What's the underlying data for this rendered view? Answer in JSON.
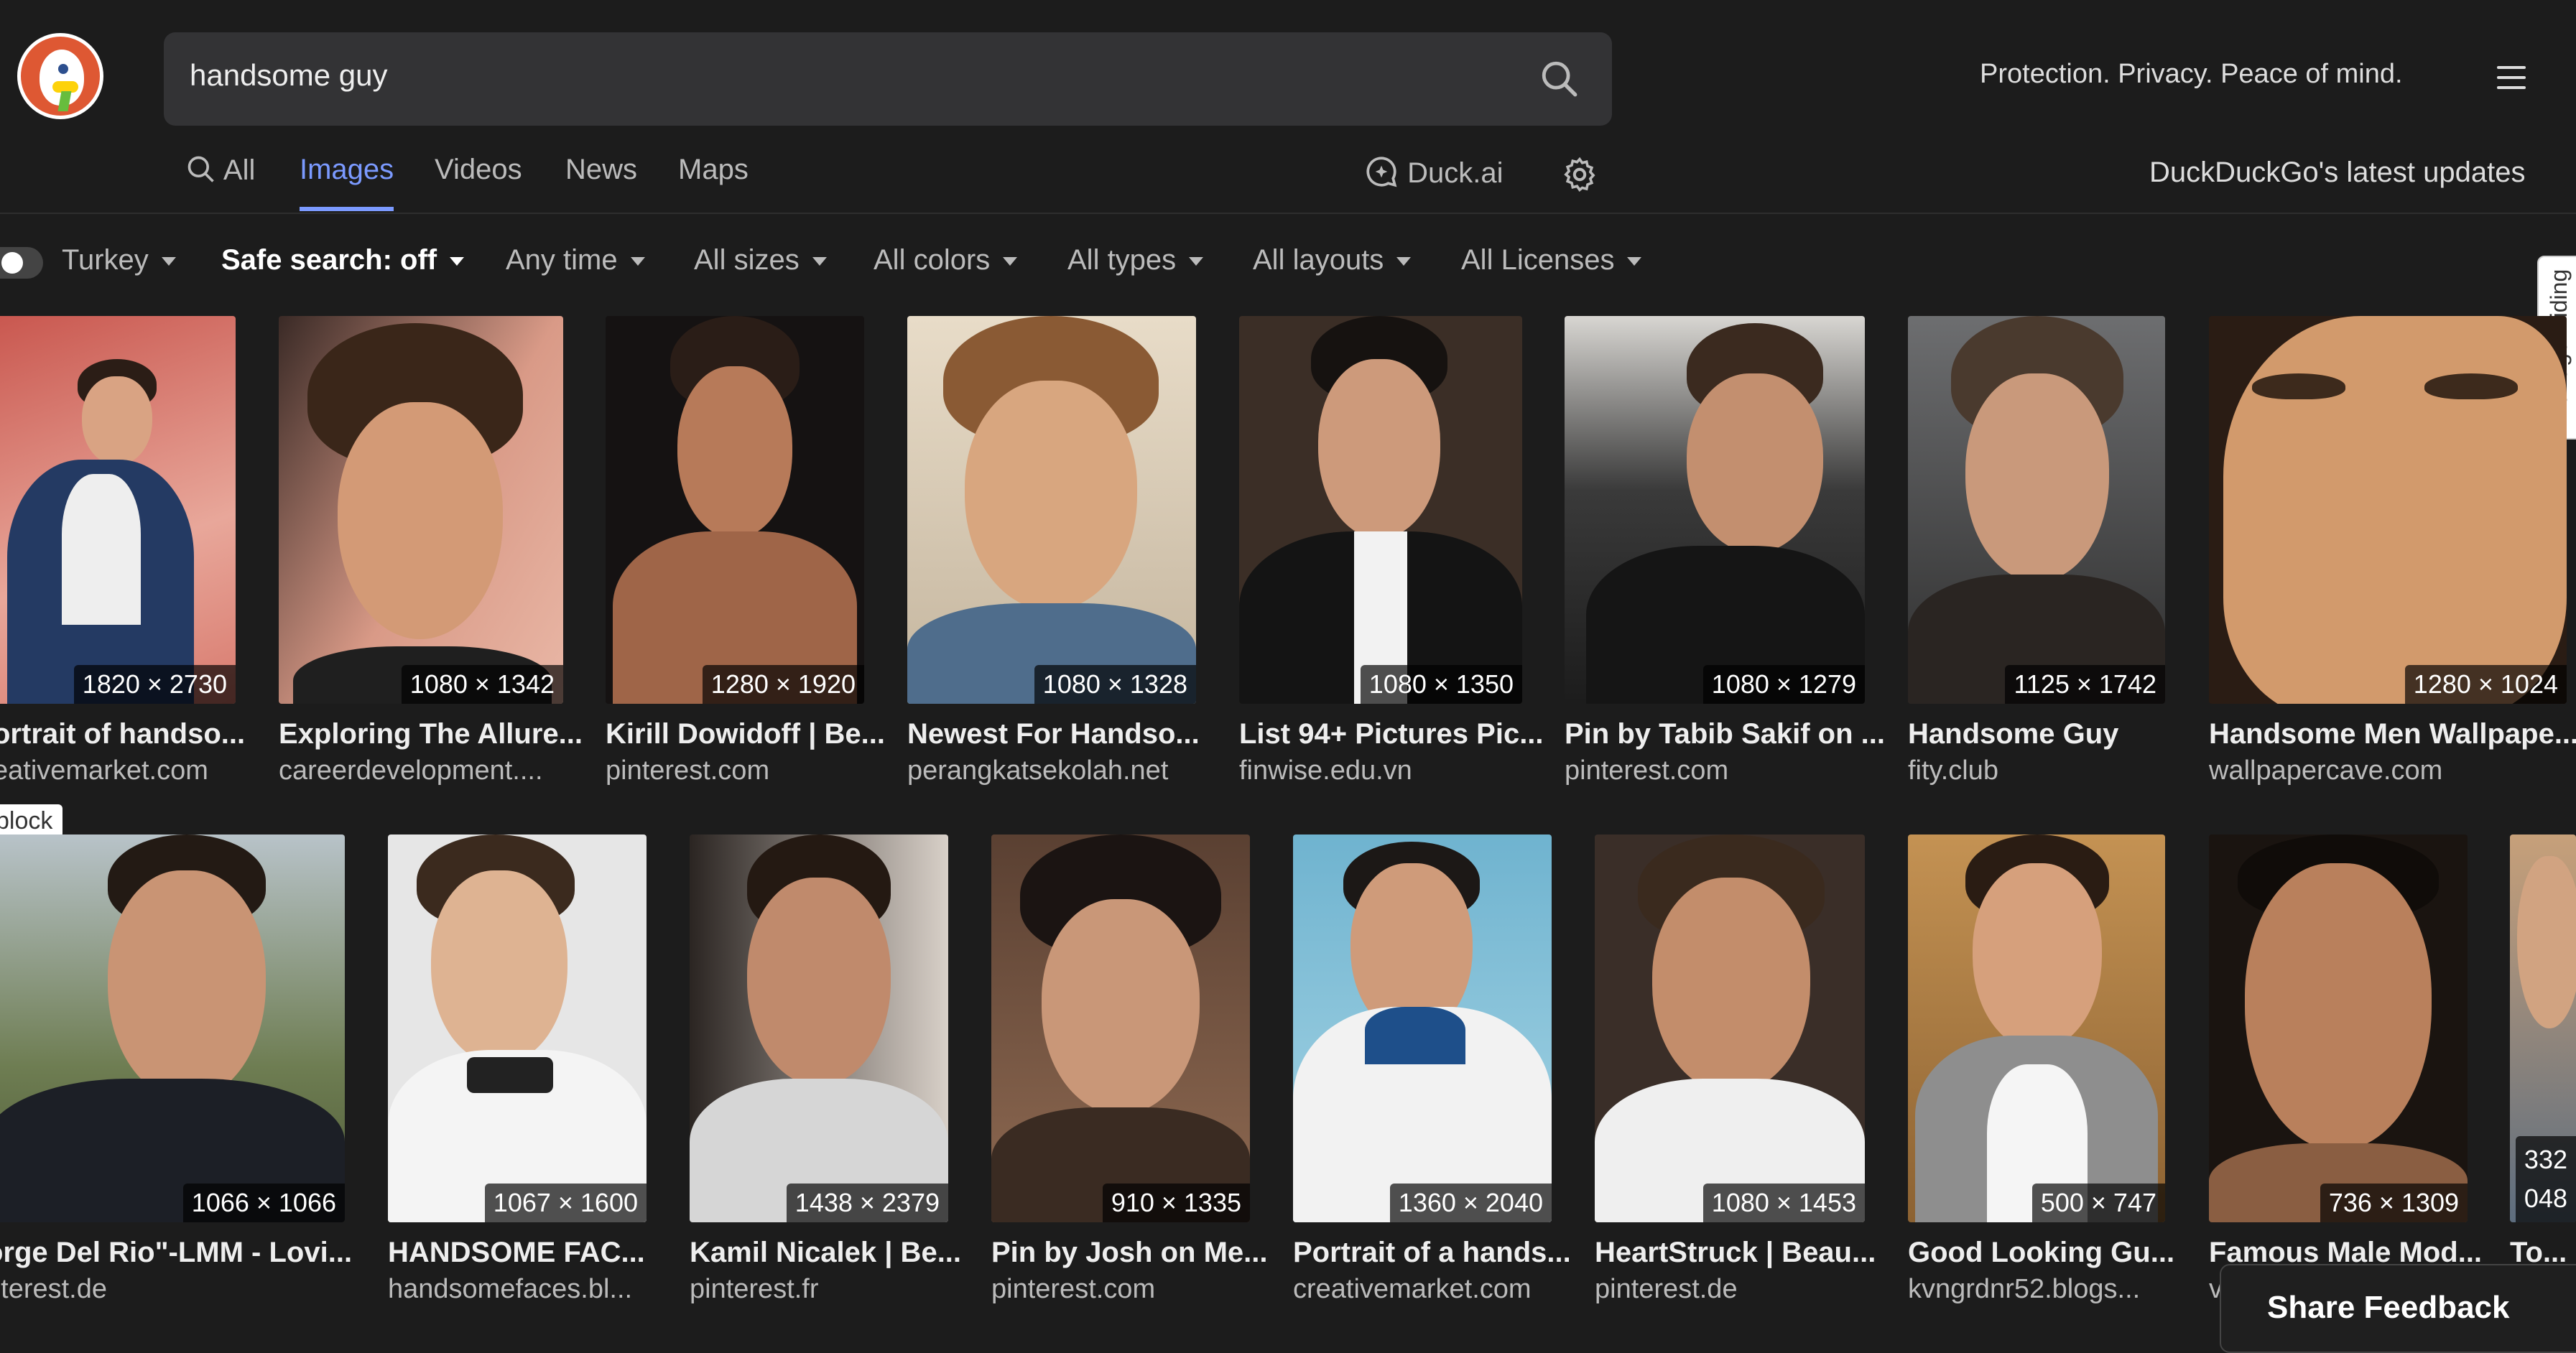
{
  "search": {
    "query": "handsome guy"
  },
  "header": {
    "tagline": "Protection. Privacy. Peace of mind."
  },
  "tabs": [
    {
      "label": "All",
      "icon": "search-icon",
      "active": false
    },
    {
      "label": "Images",
      "active": true
    },
    {
      "label": "Videos",
      "active": false
    },
    {
      "label": "News",
      "active": false
    },
    {
      "label": "Maps",
      "active": false
    }
  ],
  "duckai": {
    "label": "Duck.ai"
  },
  "updates_link": "DuckDuckGo's latest updates",
  "filters": {
    "region": "Turkey",
    "safe_search": "Safe search: off",
    "time": "Any time",
    "sizes": "All sizes",
    "colors": "All colors",
    "types": "All types",
    "layouts": "All layouts",
    "licenses": "All Licenses"
  },
  "manage_hiding": "Manage Hiding",
  "block_label": "block",
  "feedback_label": "Share Feedback",
  "row1": [
    {
      "dims": "1820 × 2730",
      "title": "ortrait of handso...",
      "source": "eativemarket.com"
    },
    {
      "dims": "1080 × 1342",
      "title": "Exploring The Allure...",
      "source": "careerdevelopment...."
    },
    {
      "dims": "1280 × 1920",
      "title": "Kirill Dowidoff | Be...",
      "source": "pinterest.com"
    },
    {
      "dims": "1080 × 1328",
      "title": "Newest For Handso...",
      "source": "perangkatsekolah.net"
    },
    {
      "dims": "1080 × 1350",
      "title": "List 94+ Pictures Pic...",
      "source": "finwise.edu.vn"
    },
    {
      "dims": "1080 × 1279",
      "title": "Pin by Tabib Sakif on ...",
      "source": "pinterest.com"
    },
    {
      "dims": "1125 × 1742",
      "title": "Handsome Guy",
      "source": "fity.club"
    },
    {
      "dims": "1280 × 1024",
      "title": "Handsome Men Wallpape...",
      "source": "wallpapercave.com"
    }
  ],
  "row2": [
    {
      "dims": "1066 × 1066",
      "title": "orge Del Rio\"-LMM - Lovi...",
      "source": "nterest.de"
    },
    {
      "dims": "1067 × 1600",
      "title": "HANDSOME FAC...",
      "source": "handsomefaces.bl..."
    },
    {
      "dims": "1438 × 2379",
      "title": "Kamil Nicalek | Be...",
      "source": "pinterest.fr"
    },
    {
      "dims": "910 × 1335",
      "title": "Pin by Josh on Me...",
      "source": "pinterest.com"
    },
    {
      "dims": "1360 × 2040",
      "title": "Portrait of a hands...",
      "source": "creativemarket.com"
    },
    {
      "dims": "1080 × 1453",
      "title": "HeartStruck | Beau...",
      "source": "pinterest.de"
    },
    {
      "dims": "500 × 747",
      "title": "Good Looking Gu...",
      "source": "kvngrdnr52.blogs..."
    },
    {
      "dims": "736 × 1309",
      "title": "Famous Male Mod...",
      "source": "v"
    },
    {
      "dims": "332\n048",
      "title": "To...",
      "source": ""
    }
  ]
}
